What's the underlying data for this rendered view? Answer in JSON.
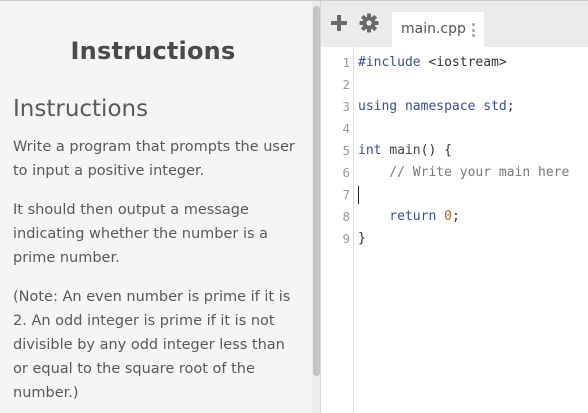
{
  "instructions_panel": {
    "header": "Instructions",
    "heading": "Instructions",
    "paragraphs": [
      "Write a program that prompts the user to input a positive integer.",
      "It should then output a message indicating whether the number is a prime number.",
      "(Note: An even number is prime if it is 2. An odd integer is prime if it is not divisible by any odd integer less than or equal to the square root of the number.)"
    ]
  },
  "toolbar": {
    "add_icon": "plus-icon",
    "settings_icon": "gear-icon"
  },
  "editor": {
    "active_file": "main.cpp",
    "line_numbers": [
      "1",
      "2",
      "3",
      "4",
      "5",
      "6",
      "7",
      "8",
      "9"
    ],
    "code": {
      "l1_kw": "#include",
      "l1_rest": " <iostream>",
      "l3_kw1": "using",
      "l3_kw2": "namespace",
      "l3_std": "std",
      "l3_semi": ";",
      "l5_type": "int",
      "l5_fn": "main",
      "l5_rest": "() {",
      "l6_comment": "    // Write your main here",
      "l8_kw": "    return",
      "l8_num": "0",
      "l8_semi": ";",
      "l9": "}"
    },
    "cursor_line": "7"
  },
  "colors": {
    "panel_bg": "#f5f5f5",
    "toolbar_bg": "#ebebeb",
    "keyword": "#3b4d8a",
    "comment": "#7a7a7a",
    "number": "#b86a1f"
  }
}
